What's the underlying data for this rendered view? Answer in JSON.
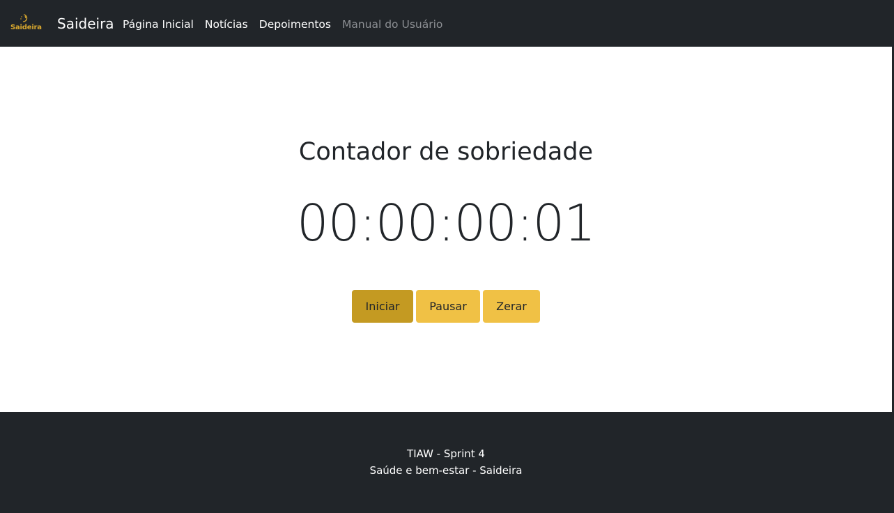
{
  "navbar": {
    "logo_text": "Saideira",
    "brand": "Saideira",
    "links": [
      {
        "label": "Página Inicial"
      },
      {
        "label": "Notícias"
      },
      {
        "label": "Depoimentos"
      },
      {
        "label": "Manual do Usuário"
      }
    ],
    "colors": {
      "background": "#212529",
      "logo_accent": "#d9a82e",
      "muted_link": "#8c8f93"
    }
  },
  "main": {
    "title": "Contador de sobriedade",
    "timer": "00:00:00:01",
    "buttons": {
      "start_label": "Iniciar",
      "pause_label": "Pausar",
      "reset_label": "Zerar"
    },
    "colors": {
      "button": "#f0c145",
      "button_active": "#c49a22"
    }
  },
  "footer": {
    "line1": "TIAW - Sprint 4",
    "line2": "Saúde e bem-estar - Saideira"
  }
}
